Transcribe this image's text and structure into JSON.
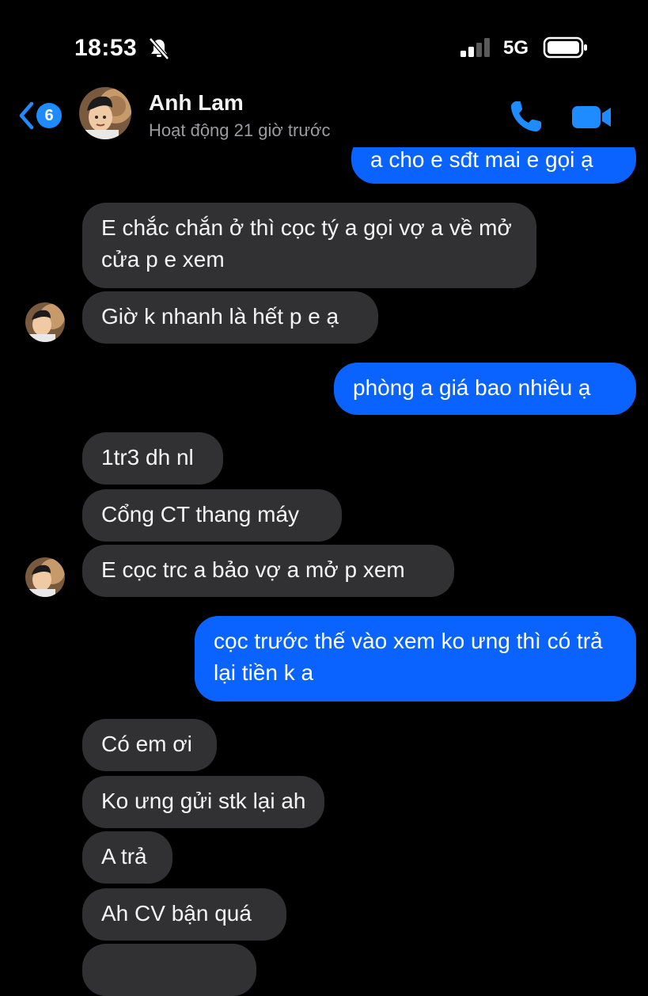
{
  "status_bar": {
    "time": "18:53",
    "network": "5G",
    "mute_icon": "bell-slash-icon",
    "signal_icon": "cellular-signal-icon",
    "battery_icon": "battery-icon"
  },
  "header": {
    "back_badge": "6",
    "contact_name": "Anh Lam",
    "contact_status": "Hoạt động 21 giờ trước",
    "back_icon": "chevron-left-icon",
    "call_icon": "phone-icon",
    "video_icon": "video-camera-icon"
  },
  "messages": [
    {
      "side": "out",
      "text": "a cho e sđt mai e gọi ạ"
    },
    {
      "side": "in",
      "text": "E chắc chắn ở thì cọc tý a gọi vợ a về mở cửa p e xem"
    },
    {
      "side": "in",
      "text": "Giờ k nhanh là hết p e ạ"
    },
    {
      "side": "out",
      "text": "phòng a giá bao nhiêu ạ"
    },
    {
      "side": "in",
      "text": "1tr3 dh nl"
    },
    {
      "side": "in",
      "text": "Cổng CT thang máy"
    },
    {
      "side": "in",
      "text": "E cọc trc a bảo vợ a mở p xem"
    },
    {
      "side": "out",
      "text": "cọc trước thế vào xem ko ưng thì có trả lại tiền k a"
    },
    {
      "side": "in",
      "text": "Có em ơi"
    },
    {
      "side": "in",
      "text": "Ko ưng gửi stk lại ah"
    },
    {
      "side": "in",
      "text": "A trả"
    },
    {
      "side": "in",
      "text": "Ah CV bận quá"
    }
  ],
  "colors": {
    "background": "#000000",
    "incoming_bubble": "#313133",
    "outgoing_bubble": "#0a63ff",
    "accent": "#1e8bff",
    "secondary_text": "#9a9aa0"
  }
}
